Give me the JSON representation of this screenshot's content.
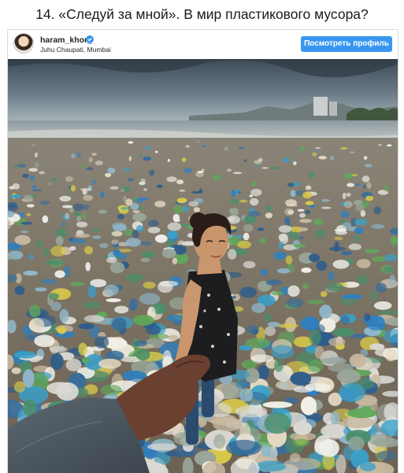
{
  "article": {
    "headline": "14. «Следуй за мной». В мир пластикового мусора?"
  },
  "post": {
    "username": "haram_khor_",
    "verified_icon": "verified-badge-icon",
    "location": "Juhu Chaupati, Mumbai",
    "profile_button_label": "Посмотреть профиль",
    "accent_color": "#3897f0",
    "photo_description_icon": "photo"
  }
}
